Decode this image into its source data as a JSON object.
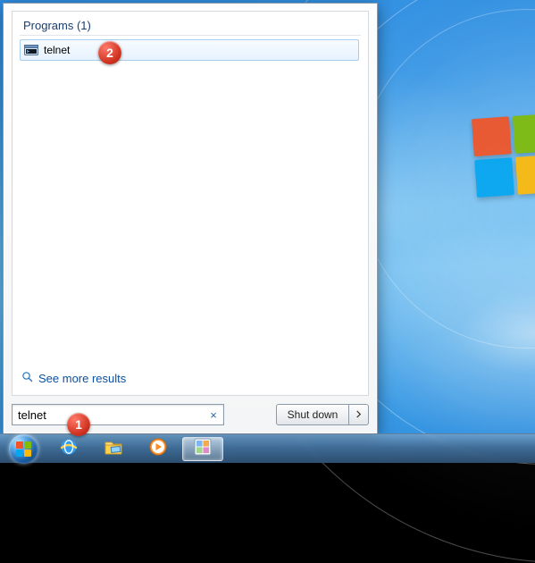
{
  "menu": {
    "category_label": "Programs (1)",
    "results": [
      {
        "label": "telnet",
        "icon": "terminal-icon"
      }
    ],
    "see_more_label": "See more results",
    "search_value": "telnet",
    "shutdown_label": "Shut down"
  },
  "taskbar": {
    "items": [
      {
        "name": "start-orb",
        "active": false
      },
      {
        "name": "internet-explorer-icon",
        "active": false
      },
      {
        "name": "file-explorer-icon",
        "active": false
      },
      {
        "name": "media-player-icon",
        "active": false
      },
      {
        "name": "app-icon",
        "active": true
      }
    ]
  },
  "callouts": [
    {
      "n": "1"
    },
    {
      "n": "2"
    }
  ],
  "colors": {
    "accent_blue": "#2f7abf",
    "callout_red": "#d23522",
    "link_blue": "#0b4f9e"
  }
}
